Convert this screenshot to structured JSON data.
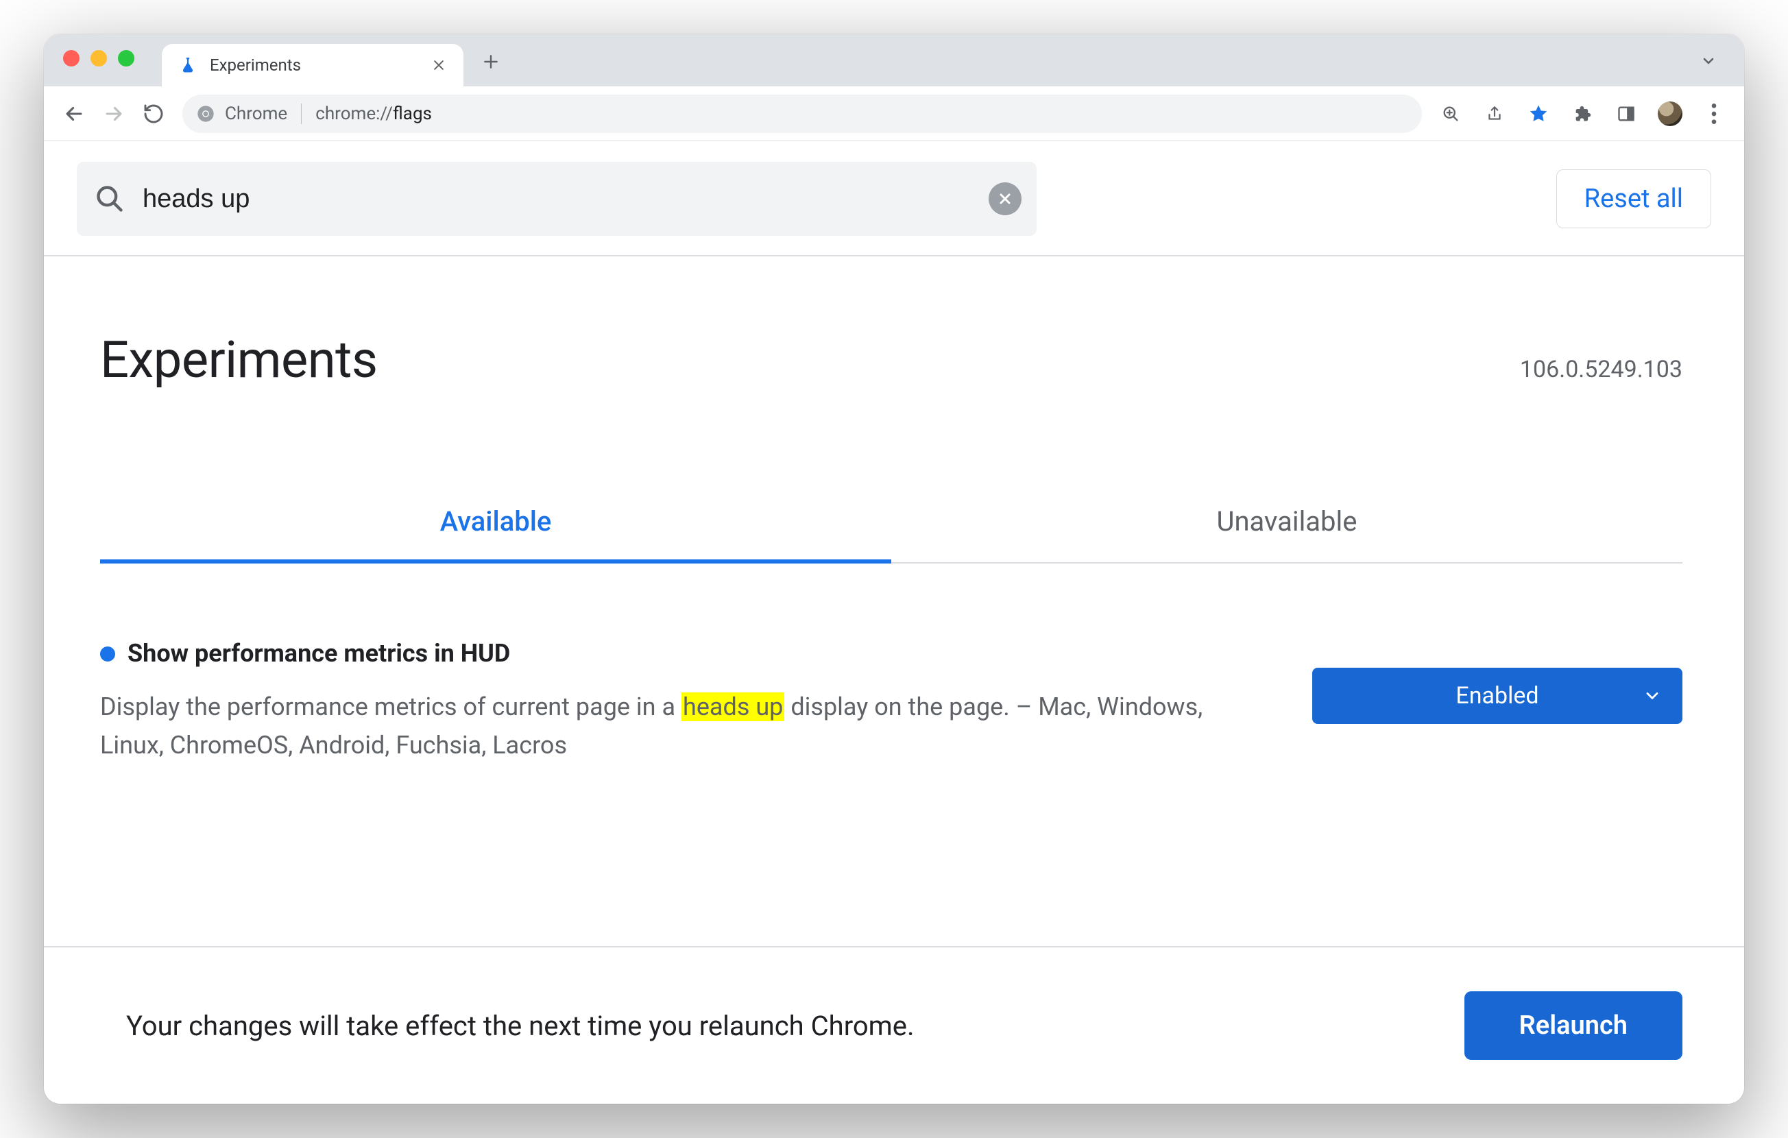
{
  "browser": {
    "tab_title": "Experiments",
    "omnibox_label": "Chrome",
    "omnibox_url_prefix": "chrome://",
    "omnibox_url_path": "flags"
  },
  "search": {
    "value": "heads up",
    "reset_all_label": "Reset all"
  },
  "heading": "Experiments",
  "version": "106.0.5249.103",
  "tabs": {
    "available": "Available",
    "unavailable": "Unavailable"
  },
  "flag": {
    "title": "Show performance metrics in HUD",
    "desc_before": "Display the performance metrics of current page in a ",
    "desc_highlight": "heads up",
    "desc_after": " display on the page. – Mac, Windows, Linux, ChromeOS, Android, Fuchsia, Lacros",
    "select_value": "Enabled"
  },
  "relaunch": {
    "message": "Your changes will take effect the next time you relaunch Chrome.",
    "button": "Relaunch"
  }
}
